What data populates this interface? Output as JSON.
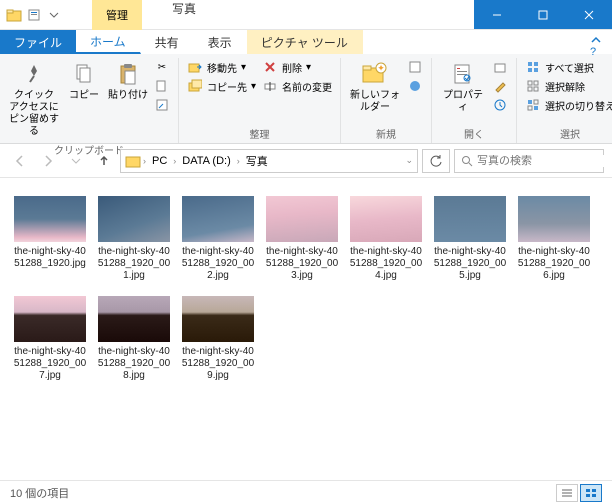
{
  "window": {
    "contextual_tab_label": "管理",
    "title": "写真"
  },
  "tabs": {
    "file": "ファイル",
    "home": "ホーム",
    "share": "共有",
    "view": "表示",
    "picture_tools": "ピクチャ ツール"
  },
  "ribbon": {
    "clipboard": {
      "pin": "クイック アクセスにピン留めする",
      "copy": "コピー",
      "paste": "貼り付け",
      "group_label": "クリップボード"
    },
    "organize": {
      "move_to": "移動先",
      "copy_to": "コピー先",
      "delete": "削除",
      "rename": "名前の変更",
      "group_label": "整理"
    },
    "new": {
      "new_folder": "新しいフォルダー",
      "group_label": "新規"
    },
    "open": {
      "properties": "プロパティ",
      "group_label": "開く"
    },
    "select": {
      "select_all": "すべて選択",
      "select_none": "選択解除",
      "invert": "選択の切り替え",
      "group_label": "選択"
    }
  },
  "breadcrumb": {
    "pc": "PC",
    "drive": "DATA (D:)",
    "folder": "写真"
  },
  "search": {
    "placeholder": "写真の検索"
  },
  "files": [
    {
      "name": "the-night-sky-4051288_1920.jpg",
      "thumb": "sky1"
    },
    {
      "name": "the-night-sky-4051288_1920_001.jpg",
      "thumb": "sky2"
    },
    {
      "name": "the-night-sky-4051288_1920_002.jpg",
      "thumb": "sky3"
    },
    {
      "name": "the-night-sky-4051288_1920_003.jpg",
      "thumb": "sky4"
    },
    {
      "name": "the-night-sky-4051288_1920_004.jpg",
      "thumb": "sky5"
    },
    {
      "name": "the-night-sky-4051288_1920_005.jpg",
      "thumb": "sky6"
    },
    {
      "name": "the-night-sky-4051288_1920_006.jpg",
      "thumb": "sky7"
    },
    {
      "name": "the-night-sky-4051288_1920_007.jpg",
      "thumb": "sky8"
    },
    {
      "name": "the-night-sky-4051288_1920_008.jpg",
      "thumb": "sky9"
    },
    {
      "name": "the-night-sky-4051288_1920_009.jpg",
      "thumb": "sky10"
    }
  ],
  "status": {
    "count_label": "10 個の項目"
  }
}
